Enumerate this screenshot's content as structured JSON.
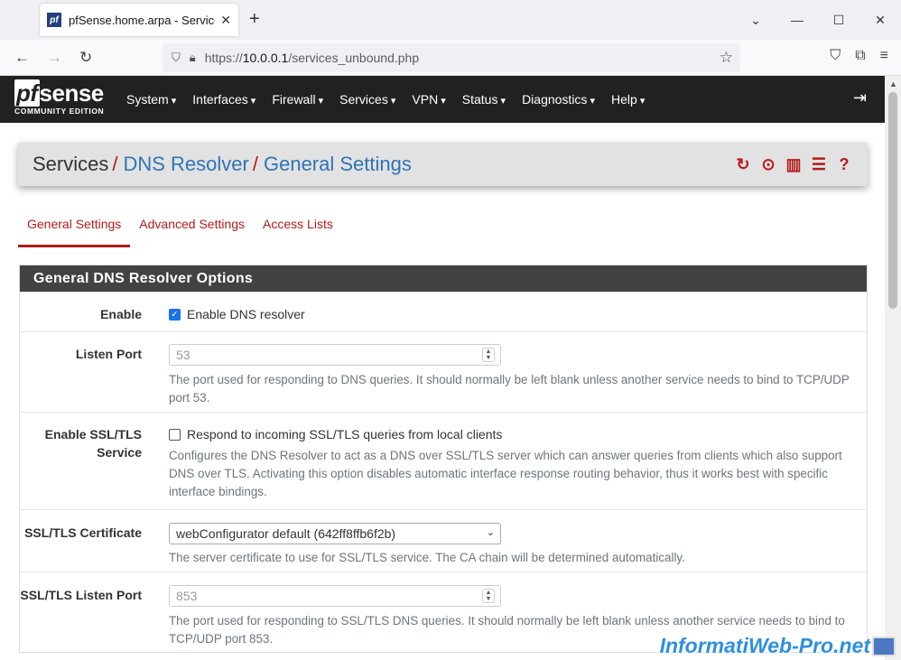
{
  "browser": {
    "tab_title": "pfSense.home.arpa - Services: D",
    "favicon_text": "pf",
    "url_scheme": "https://",
    "url_host": "10.0.0.1",
    "url_path": "/services_unbound.php"
  },
  "header": {
    "logo_pf": "pf",
    "logo_sense": "sense",
    "logo_sub": "COMMUNITY EDITION",
    "menu": [
      "System",
      "Interfaces",
      "Firewall",
      "Services",
      "VPN",
      "Status",
      "Diagnostics",
      "Help"
    ]
  },
  "breadcrumb": {
    "home": "Services",
    "section": "DNS Resolver",
    "page": "General Settings"
  },
  "tabs": {
    "general": "General Settings",
    "advanced": "Advanced Settings",
    "access": "Access Lists"
  },
  "panel": {
    "title": "General DNS Resolver Options",
    "enable": {
      "label": "Enable",
      "checkbox_label": "Enable DNS resolver",
      "checked": true
    },
    "listen_port": {
      "label": "Listen Port",
      "placeholder": "53",
      "help": "The port used for responding to DNS queries. It should normally be left blank unless another service needs to bind to TCP/UDP port 53."
    },
    "ssl_tls": {
      "label": "Enable SSL/TLS Service",
      "checkbox_label": "Respond to incoming SSL/TLS queries from local clients",
      "checked": false,
      "help": "Configures the DNS Resolver to act as a DNS over SSL/TLS server which can answer queries from clients which also support DNS over TLS. Activating this option disables automatic interface response routing behavior, thus it works best with specific interface bindings."
    },
    "ssl_cert": {
      "label": "SSL/TLS Certificate",
      "selected": "webConfigurator default (642ff8ffb6f2b)",
      "help": "The server certificate to use for SSL/TLS service. The CA chain will be determined automatically."
    },
    "ssl_port": {
      "label": "SSL/TLS Listen Port",
      "placeholder": "853",
      "help": "The port used for responding to SSL/TLS DNS queries. It should normally be left blank unless another service needs to bind to TCP/UDP port 853."
    }
  },
  "watermark": "InformatiWeb-Pro.net"
}
